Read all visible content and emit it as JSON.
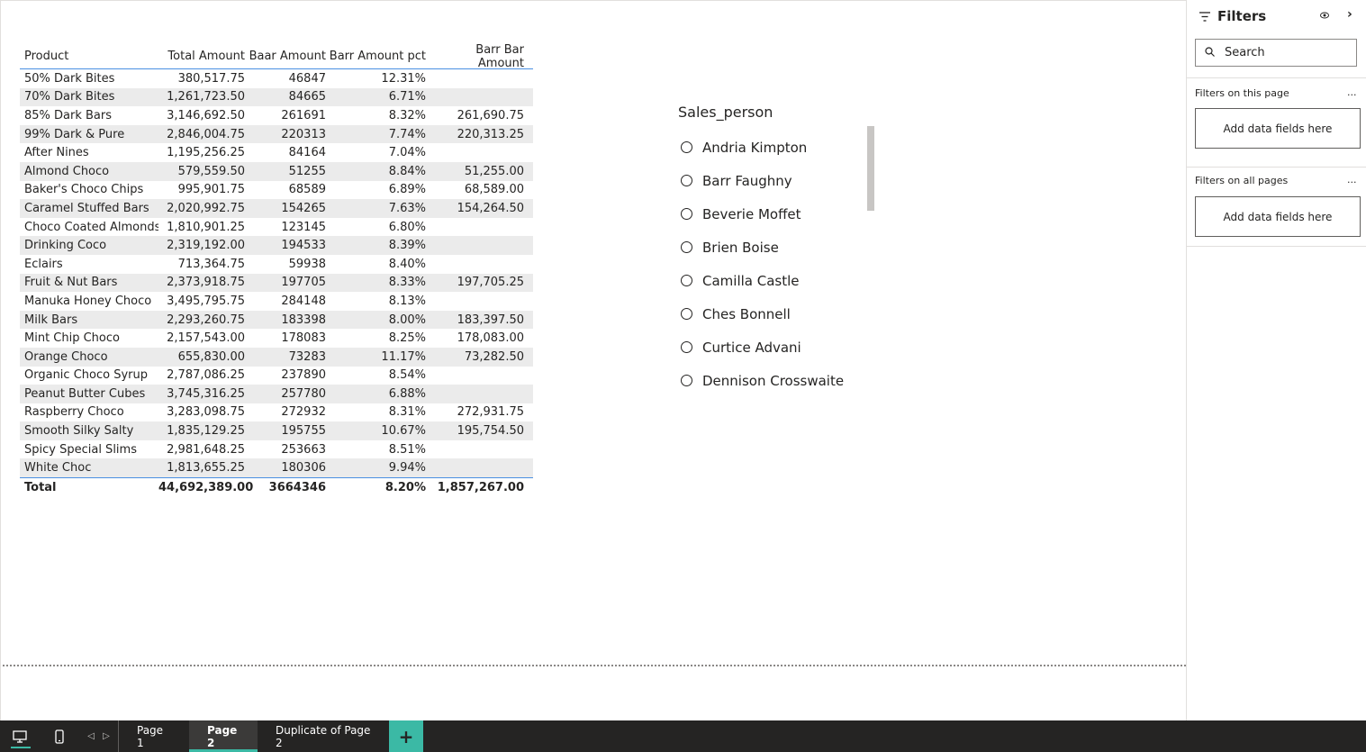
{
  "table": {
    "headers": [
      "Product",
      "Total Amount",
      "Baar Amount",
      "Barr Amount pct",
      "Barr Bar Amount"
    ],
    "rows": [
      [
        "50% Dark Bites",
        "380,517.75",
        "46847",
        "12.31%",
        ""
      ],
      [
        "70% Dark Bites",
        "1,261,723.50",
        "84665",
        "6.71%",
        ""
      ],
      [
        "85% Dark Bars",
        "3,146,692.50",
        "261691",
        "8.32%",
        "261,690.75"
      ],
      [
        "99% Dark & Pure",
        "2,846,004.75",
        "220313",
        "7.74%",
        "220,313.25"
      ],
      [
        "After Nines",
        "1,195,256.25",
        "84164",
        "7.04%",
        ""
      ],
      [
        "Almond Choco",
        "579,559.50",
        "51255",
        "8.84%",
        "51,255.00"
      ],
      [
        "Baker's Choco Chips",
        "995,901.75",
        "68589",
        "6.89%",
        "68,589.00"
      ],
      [
        "Caramel Stuffed Bars",
        "2,020,992.75",
        "154265",
        "7.63%",
        "154,264.50"
      ],
      [
        "Choco Coated Almonds",
        "1,810,901.25",
        "123145",
        "6.80%",
        ""
      ],
      [
        "Drinking Coco",
        "2,319,192.00",
        "194533",
        "8.39%",
        ""
      ],
      [
        "Eclairs",
        "713,364.75",
        "59938",
        "8.40%",
        ""
      ],
      [
        "Fruit & Nut Bars",
        "2,373,918.75",
        "197705",
        "8.33%",
        "197,705.25"
      ],
      [
        "Manuka Honey Choco",
        "3,495,795.75",
        "284148",
        "8.13%",
        ""
      ],
      [
        "Milk Bars",
        "2,293,260.75",
        "183398",
        "8.00%",
        "183,397.50"
      ],
      [
        "Mint Chip Choco",
        "2,157,543.00",
        "178083",
        "8.25%",
        "178,083.00"
      ],
      [
        "Orange Choco",
        "655,830.00",
        "73283",
        "11.17%",
        "73,282.50"
      ],
      [
        "Organic Choco Syrup",
        "2,787,086.25",
        "237890",
        "8.54%",
        ""
      ],
      [
        "Peanut Butter Cubes",
        "3,745,316.25",
        "257780",
        "6.88%",
        ""
      ],
      [
        "Raspberry Choco",
        "3,283,098.75",
        "272932",
        "8.31%",
        "272,931.75"
      ],
      [
        "Smooth Silky Salty",
        "1,835,129.25",
        "195755",
        "10.67%",
        "195,754.50"
      ],
      [
        "Spicy Special Slims",
        "2,981,648.25",
        "253663",
        "8.51%",
        ""
      ],
      [
        "White Choc",
        "1,813,655.25",
        "180306",
        "9.94%",
        ""
      ]
    ],
    "total": [
      "Total",
      "44,692,389.00",
      "3664346",
      "8.20%",
      "1,857,267.00"
    ]
  },
  "slicer": {
    "title": "Sales_person",
    "items": [
      "Andria Kimpton",
      "Barr Faughny",
      "Beverie Moffet",
      "Brien Boise",
      "Camilla Castle",
      "Ches Bonnell",
      "Curtice Advani",
      "Dennison Crosswaite"
    ]
  },
  "filters": {
    "title": "Filters",
    "search_placeholder": "Search",
    "section_page": "Filters on this page",
    "section_all": "Filters on all pages",
    "drop_label_page": "Add data fields here",
    "drop_label_all": "Add data fields here",
    "more": "..."
  },
  "tabs": {
    "items": [
      "Page 1",
      "Page 2",
      "Duplicate of Page 2"
    ],
    "active": "Page 2",
    "add": "+"
  },
  "colors": {
    "accent": "#3bb9a5",
    "table_line": "#4a90e2",
    "bottom_bar": "#252423",
    "row_alt": "#ebebeb"
  }
}
